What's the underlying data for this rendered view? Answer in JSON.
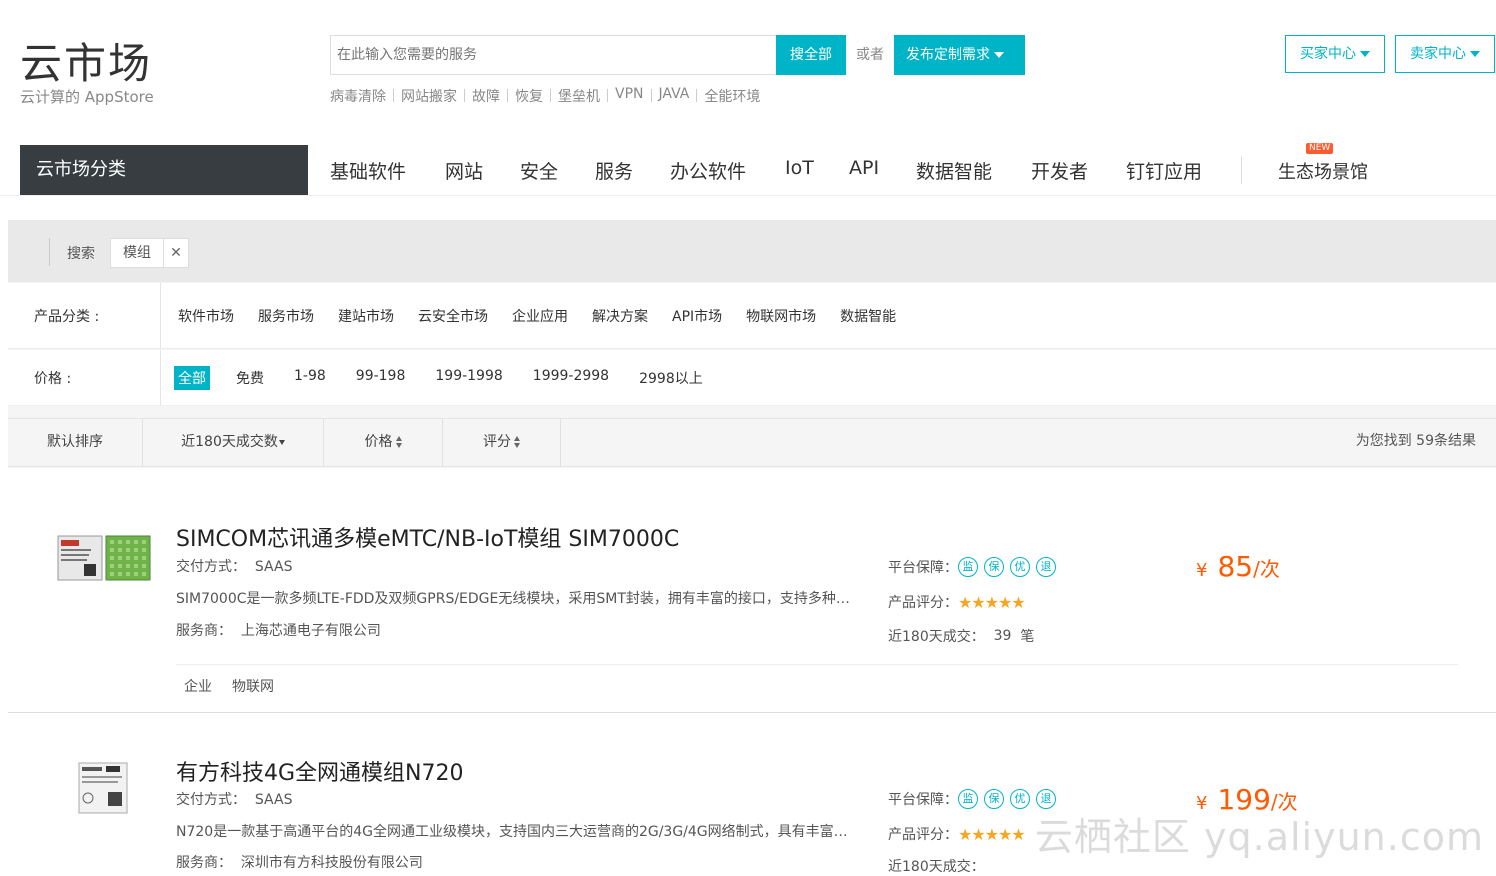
{
  "header": {
    "logo_title": "云市场",
    "logo_subtitle": "云计算的 AppStore",
    "search_placeholder": "在此输入您需要的服务",
    "search_button": "搜全部",
    "or_text": "或者",
    "publish_button": "发布定制需求",
    "hot_words": [
      "病毒清除",
      "网站搬家",
      "故障",
      "恢复",
      "堡垒机",
      "VPN",
      "JAVA",
      "全能环境"
    ],
    "buyer_center": "买家中心",
    "seller_center": "卖家中心"
  },
  "nav": {
    "category_label": "云市场分类",
    "items": [
      "基础软件",
      "网站",
      "安全",
      "服务",
      "办公软件",
      "IoT",
      "API",
      "数据智能",
      "开发者",
      "钉钉应用"
    ],
    "eco_label": "生态场景馆",
    "new_badge": "NEW"
  },
  "filter": {
    "crumb_label": "搜索",
    "crumb_keyword": "模组",
    "crumb_close": "✕",
    "category_label": "产品分类 :",
    "categories": [
      "软件市场",
      "服务市场",
      "建站市场",
      "云安全市场",
      "企业应用",
      "解决方案",
      "API市场",
      "物联网市场",
      "数据智能"
    ],
    "price_label": "价格 :",
    "prices": [
      "全部",
      "免费",
      "1-98",
      "99-198",
      "199-1998",
      "1999-2998",
      "2998以上"
    ],
    "price_selected": "全部"
  },
  "sort": {
    "default": "默认排序",
    "sales": "近180天成交数",
    "price": "价格",
    "rating": "评分",
    "result_text": "为您找到 59条结果"
  },
  "products": [
    {
      "title": "SIMCOM芯讯通多模eMTC/NB-IoT模组 SIM7000C",
      "delivery_label": "交付方式：",
      "delivery": "SAAS",
      "description": "SIM7000C是一款多频LTE-FDD及双频GPRS/EDGE无线模块，采用SMT封装，拥有丰富的接口，支持多种网络协议",
      "vendor_label": "服务商：",
      "vendor": "上海芯通电子有限公司",
      "guarantee_label": "平台保障：",
      "guarantee_badges": [
        "监",
        "保",
        "优",
        "退"
      ],
      "rating_label": "产品评分：",
      "rating": 5,
      "sales_label": "近180天成交：",
      "sales": "39",
      "sales_unit": "笔",
      "currency": "¥",
      "price": "85",
      "price_unit": "/次",
      "tags": [
        "企业",
        "物联网"
      ]
    },
    {
      "title": "有方科技4G全网通模组N720",
      "delivery_label": "交付方式：",
      "delivery": "SAAS",
      "description": "N720是一款基于高通平台的4G全网通工业级模块，支持国内三大运营商的2G/3G/4G网络制式，具有丰富的接口",
      "vendor_label": "服务商：",
      "vendor": "深圳市有方科技股份有限公司",
      "guarantee_label": "平台保障：",
      "guarantee_badges": [
        "监",
        "保",
        "优",
        "退"
      ],
      "rating_label": "产品评分：",
      "rating": 5,
      "sales_label": "近180天成交：",
      "currency": "¥",
      "price": "199",
      "price_unit": "/次"
    }
  ],
  "watermark": "云栖社区 yq.aliyun.com",
  "colors": {
    "accent": "#00b4c8",
    "price": "#ff5a00",
    "nav_dark": "#373d41",
    "star": "#f5a623",
    "new_badge": "#ff5a2f"
  }
}
